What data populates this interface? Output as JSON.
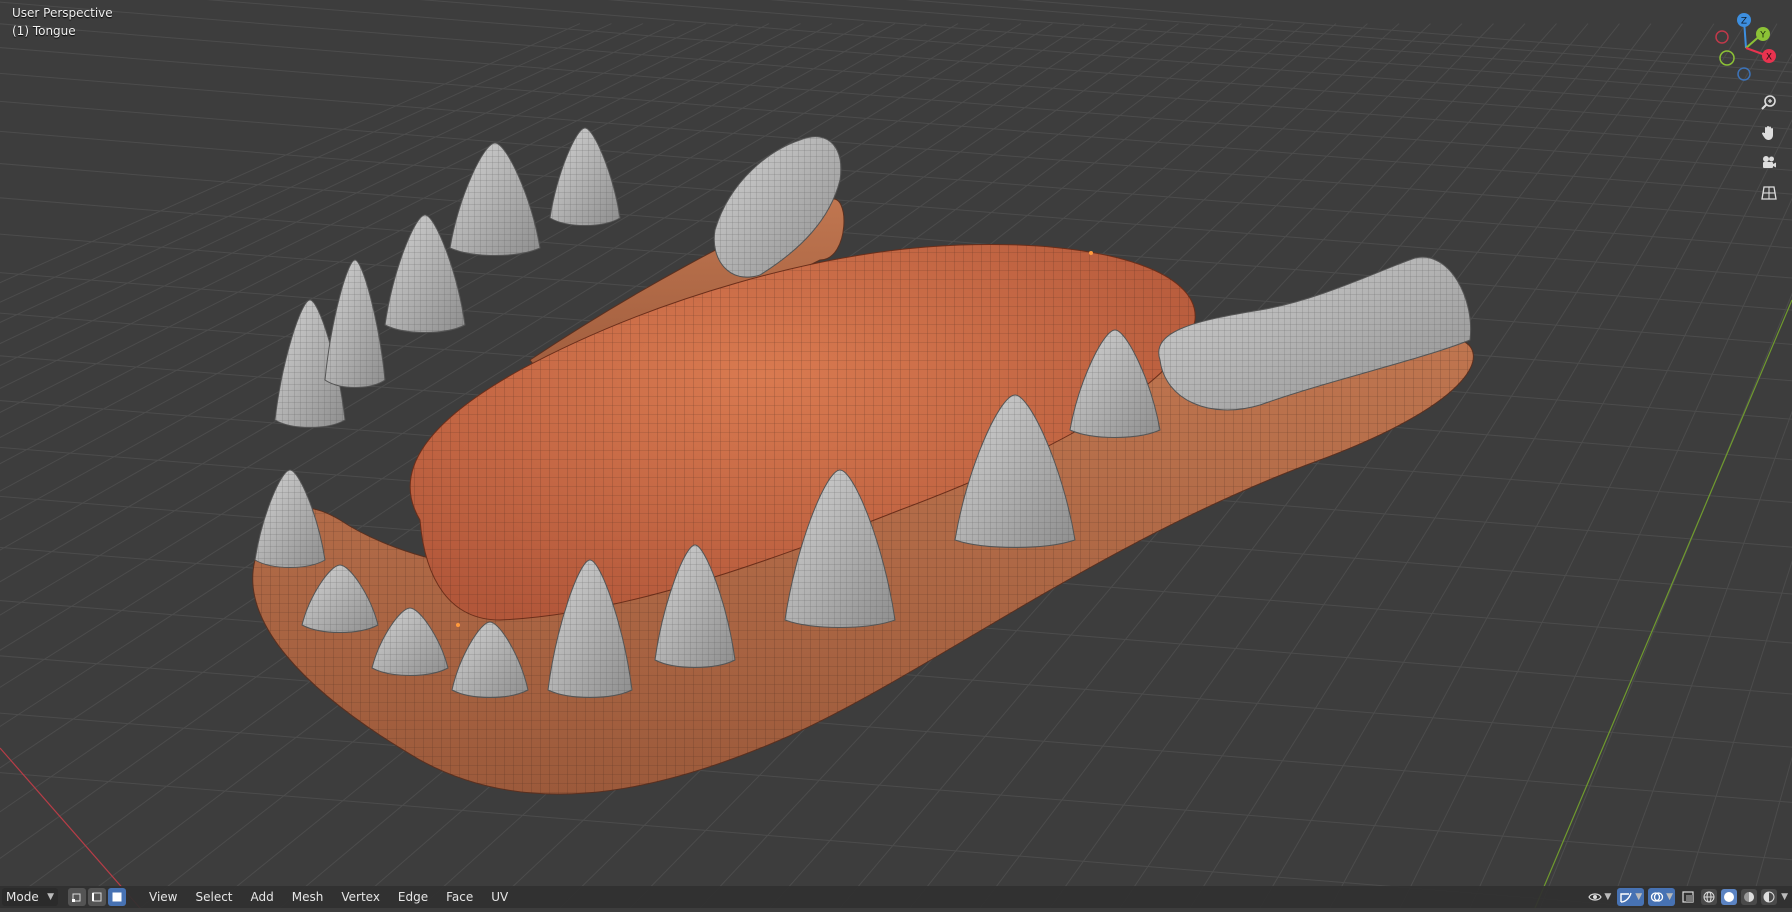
{
  "viewport": {
    "view_name": "User Perspective",
    "active_object": "(1) Tongue"
  },
  "gizmo": {
    "z_label": "Z",
    "y_label": "Y",
    "x_label": "X",
    "colors": {
      "x": "#e8334f",
      "y": "#8cc236",
      "z": "#3d8fe0"
    }
  },
  "nav_buttons": [
    "zoom-icon",
    "hand-pan-icon",
    "camera-icon",
    "grid-perspective-icon"
  ],
  "header": {
    "mode_label": "Mode",
    "menus": [
      "View",
      "Select",
      "Add",
      "Mesh",
      "Vertex",
      "Edge",
      "Face",
      "UV"
    ]
  },
  "scene": {
    "tongue_color": "#c86a44",
    "gum_color": "#b36a45",
    "teeth_color": "#b8b8b8",
    "background_color": "#3d3d3d",
    "grid_color": "#4c4c4c"
  }
}
